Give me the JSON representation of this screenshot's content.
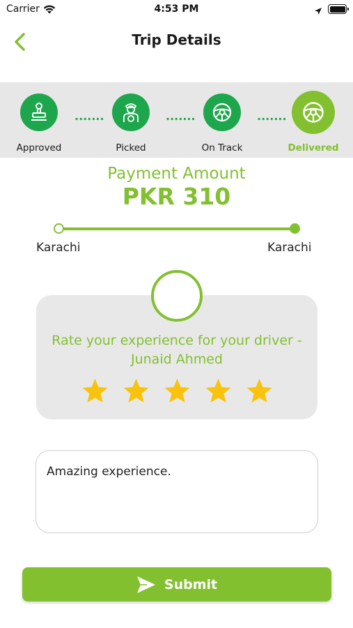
{
  "status_bar": {
    "carrier": "Carrier",
    "time": "4:53 PM"
  },
  "header": {
    "title": "Trip Details"
  },
  "steps": [
    {
      "label": "Approved",
      "icon": "stamp-icon"
    },
    {
      "label": "Picked",
      "icon": "driver-icon"
    },
    {
      "label": "On Track",
      "icon": "steering-wheel-icon"
    },
    {
      "label": "Delivered",
      "icon": "steering-wheel-icon",
      "active": true
    }
  ],
  "payment": {
    "title": "Payment Amount",
    "amount": "PKR 310"
  },
  "route": {
    "from": "Karachi",
    "to": "Karachi"
  },
  "rating": {
    "text": "Rate your experience for your driver - Junaid Ahmed",
    "stars": 5,
    "max_stars": 5
  },
  "comment": {
    "value": "Amazing experience."
  },
  "submit": {
    "label": "Submit"
  },
  "colors": {
    "accent": "#82c030",
    "step_green": "#1ea64d",
    "star": "#f9c30d",
    "tracker_bg": "#e7e7e7"
  }
}
